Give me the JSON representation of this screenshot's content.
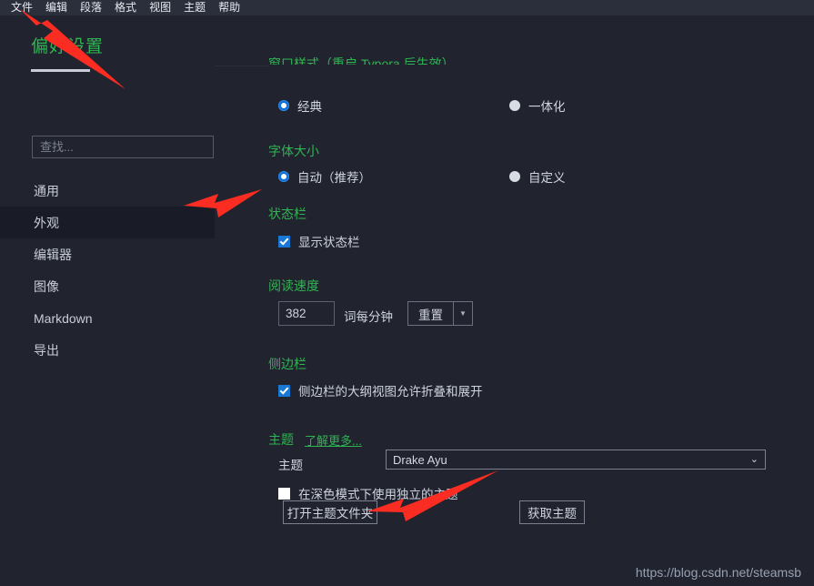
{
  "menubar": {
    "items": [
      {
        "label": "文件",
        "name": "menu-file"
      },
      {
        "label": "编辑",
        "name": "menu-edit"
      },
      {
        "label": "段落",
        "name": "menu-paragraph"
      },
      {
        "label": "格式",
        "name": "menu-format"
      },
      {
        "label": "视图",
        "name": "menu-view"
      },
      {
        "label": "主题",
        "name": "menu-theme"
      },
      {
        "label": "帮助",
        "name": "menu-help"
      }
    ]
  },
  "sidebar": {
    "title": "偏好设置",
    "search": {
      "placeholder": "查找...",
      "value": ""
    },
    "items": [
      {
        "label": "通用"
      },
      {
        "label": "外观"
      },
      {
        "label": "编辑器"
      },
      {
        "label": "图像"
      },
      {
        "label": "Markdown"
      },
      {
        "label": "导出"
      }
    ],
    "selected_index": 1
  },
  "main": {
    "clipped_section": {
      "heading": "窗口样式（重启 Typora 后生效）"
    },
    "window_style": {
      "options": [
        {
          "label": "经典",
          "selected": true
        },
        {
          "label": "一体化",
          "selected": false
        }
      ]
    },
    "font_size": {
      "heading": "字体大小",
      "options": [
        {
          "label": "自动（推荐）",
          "selected": true
        },
        {
          "label": "自定义",
          "selected": false
        }
      ]
    },
    "status_bar": {
      "heading": "状态栏",
      "checkbox": {
        "label": "显示状态栏",
        "checked": true
      }
    },
    "reading_speed": {
      "heading": "阅读速度",
      "value": "382",
      "unit_label": "词每分钟",
      "reset_button": "重置",
      "dropdown_glyph": "▼"
    },
    "sidebar_section": {
      "heading": "侧边栏",
      "checkbox": {
        "label": "侧边栏的大纲视图允许折叠和展开",
        "checked": true
      }
    },
    "theme": {
      "heading": "主题",
      "learn_more": "了解更多...",
      "field_label": "主题",
      "selected_theme": "Drake Ayu",
      "chevron_glyph": "⌄",
      "dark_mode_checkbox": {
        "label": "在深色模式下使用独立的主题",
        "checked": false
      },
      "open_folder_button": "打开主题文件夹",
      "get_theme_button": "获取主题"
    }
  },
  "watermark": {
    "text": "https://blog.csdn.net/steamsb"
  },
  "colors": {
    "background": "#21242e",
    "menubar": "#2b2f3b",
    "accent_green": "#2eb552",
    "accent_blue": "#1878d4",
    "arrow_red": "#fb2c22",
    "text": "#cfd4e0"
  }
}
